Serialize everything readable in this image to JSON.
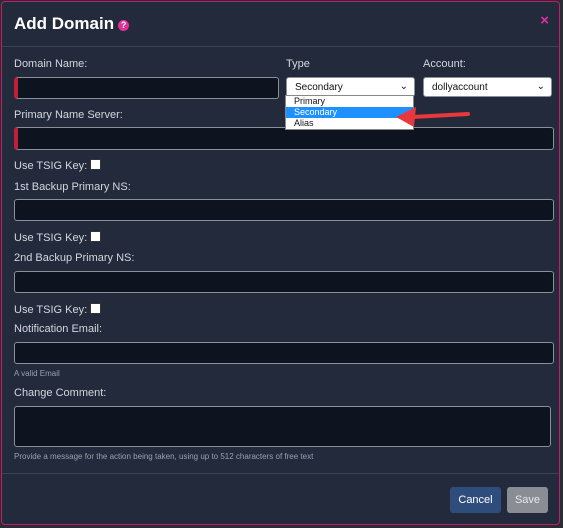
{
  "dialog": {
    "title": "Add Domain",
    "help_icon": "?",
    "close_icon": "×"
  },
  "fields": {
    "domain_name_label": "Domain Name:",
    "type_label": "Type",
    "account_label": "Account:",
    "type_value": "Secondary",
    "account_value": "dollyaccount",
    "primary_ns_label": "Primary Name Server:",
    "tsig1_label": "Use TSIG Key:",
    "backup1_label": "1st Backup Primary NS:",
    "tsig2_label": "Use TSIG Key:",
    "backup2_label": "2nd Backup Primary NS:",
    "tsig3_label": "Use TSIG Key:",
    "email_label": "Notification Email:",
    "email_hint": "A valid Email",
    "comment_label": "Change Comment:",
    "comment_hint": "Provide a message for the action being taken, using up to 512 characters of free text"
  },
  "type_options": [
    "Primary",
    "Secondary",
    "Alias"
  ],
  "buttons": {
    "cancel": "Cancel",
    "save": "Save"
  },
  "colors": {
    "accent": "#c21d6a",
    "arrow": "#e8383d",
    "option_selected": "#1e90ff"
  }
}
